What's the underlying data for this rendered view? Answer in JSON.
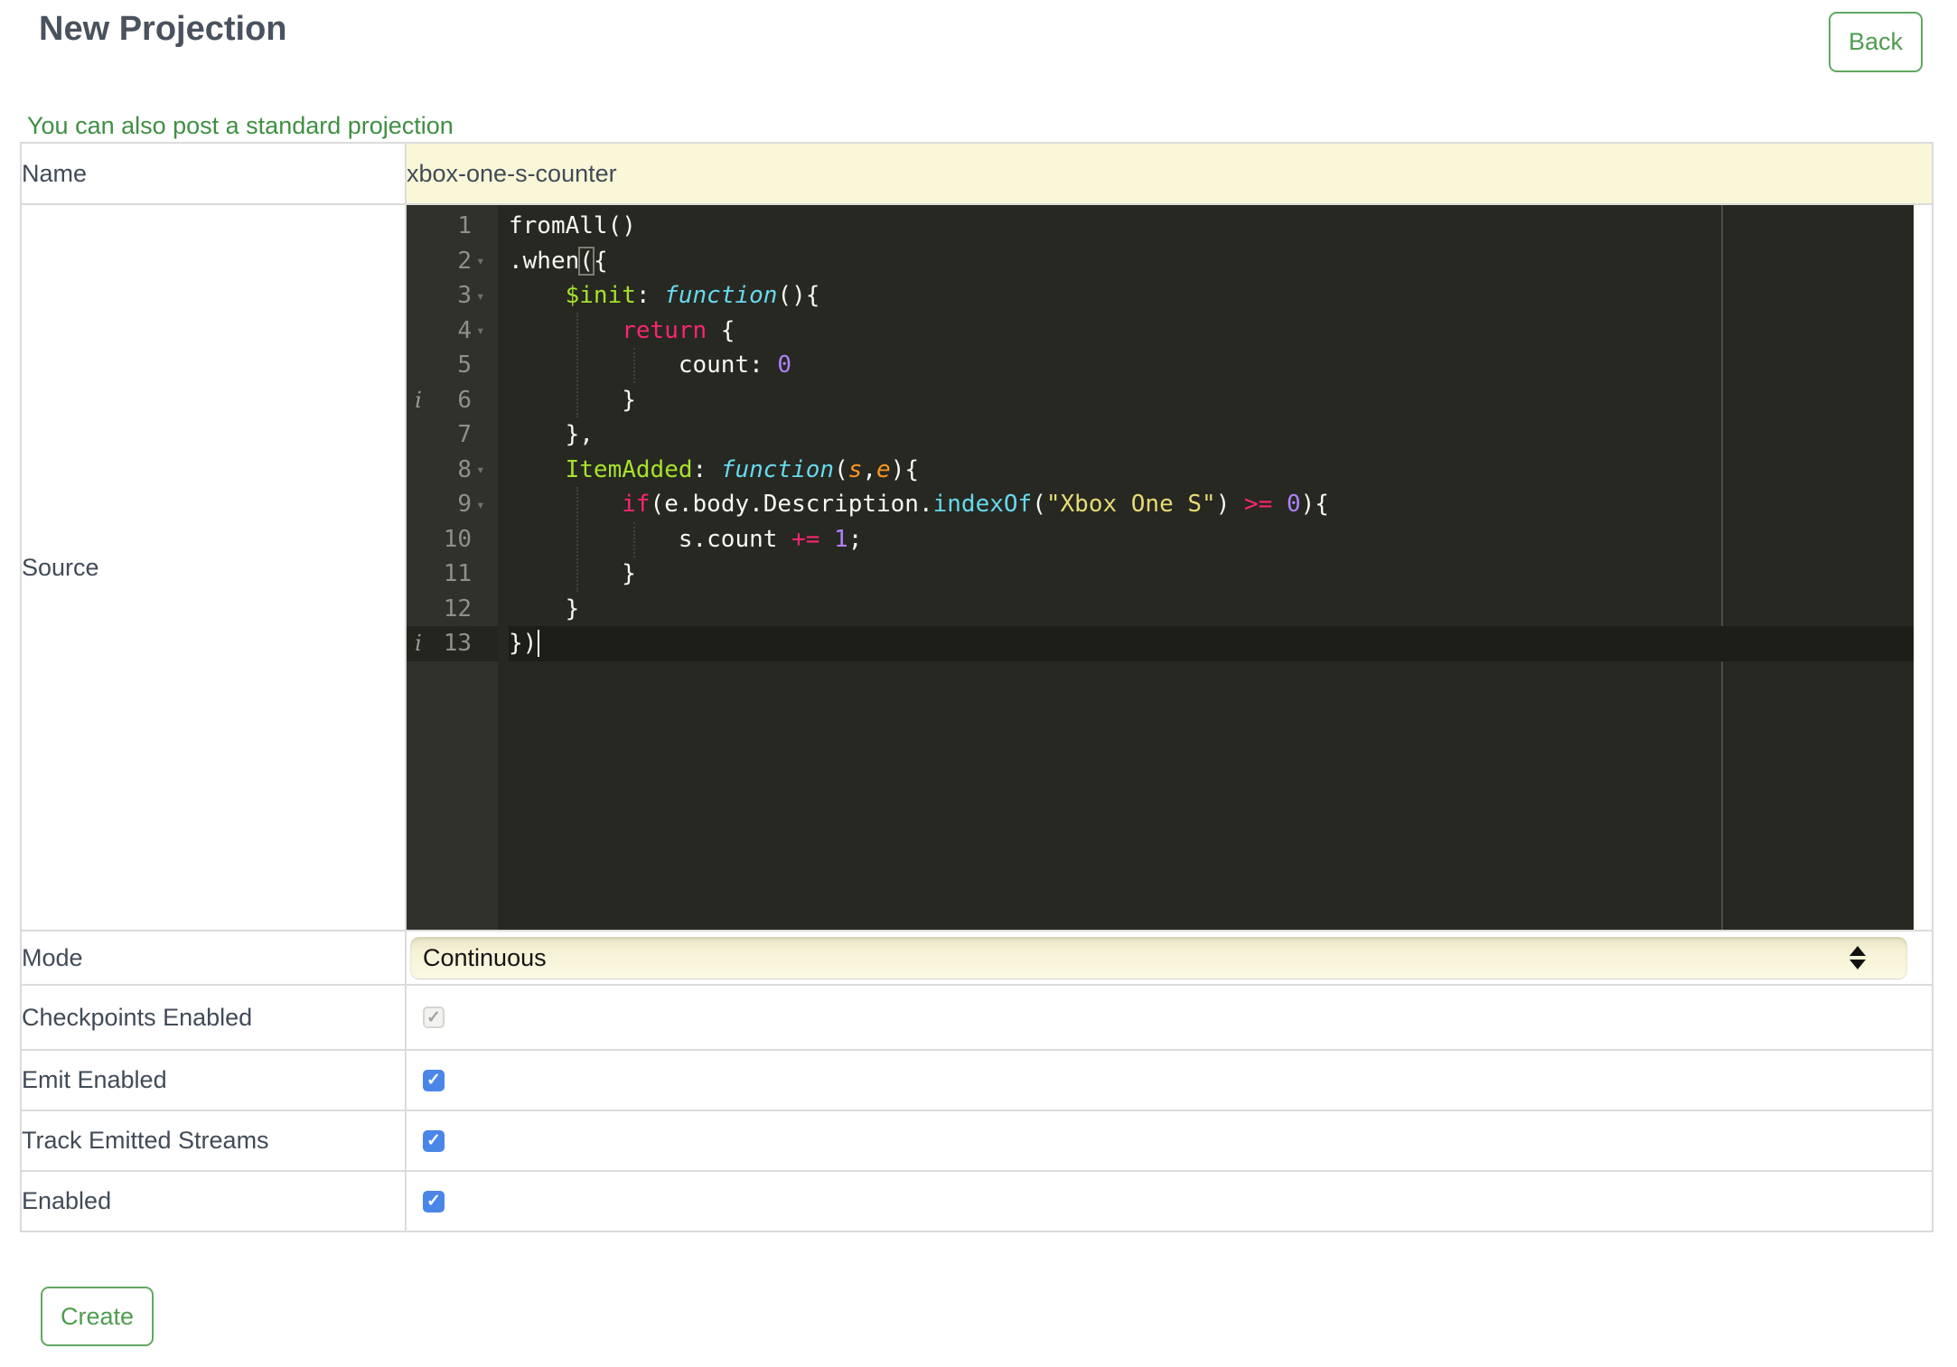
{
  "header": {
    "title": "New Projection",
    "back_label": "Back",
    "standard_projection_link": "You can also post a standard projection"
  },
  "form": {
    "name_label": "Name",
    "name_value": "xbox-one-s-counter",
    "source_label": "Source",
    "mode_label": "Mode",
    "mode_value": "Continuous",
    "checkboxes": [
      {
        "label": "Checkpoints Enabled",
        "checked": true,
        "disabled": true
      },
      {
        "label": "Emit Enabled",
        "checked": true,
        "disabled": false
      },
      {
        "label": "Track Emitted Streams",
        "checked": true,
        "disabled": false
      },
      {
        "label": "Enabled",
        "checked": true,
        "disabled": false
      }
    ],
    "create_label": "Create"
  },
  "colors": {
    "accent_green": "#4f9d4f",
    "link_green": "#3f8f42",
    "checkbox_blue": "#4a86e8",
    "name_field_yellow": "#faf7d9",
    "editor_background": "#272821",
    "gutter_background": "#30312b",
    "title_slate": "#49525e"
  },
  "editor": {
    "language": "javascript",
    "line_count": 13,
    "lines": [
      {
        "num": 1,
        "tokens": [
          {
            "t": "fromAll()",
            "c": "plain"
          }
        ]
      },
      {
        "num": 2,
        "fold": true,
        "tokens": [
          {
            "t": ".when",
            "c": "plain"
          },
          {
            "t": "(",
            "c": "plain",
            "b": true
          },
          {
            "t": "{",
            "c": "plain"
          }
        ]
      },
      {
        "num": 3,
        "fold": true,
        "tokens": [
          {
            "t": "    ",
            "c": "plain"
          },
          {
            "t": "$init",
            "c": "entity"
          },
          {
            "t": ": ",
            "c": "plain"
          },
          {
            "t": "function",
            "c": "storage"
          },
          {
            "t": "(){",
            "c": "plain"
          }
        ]
      },
      {
        "num": 4,
        "fold": true,
        "tokens": [
          {
            "t": "        ",
            "c": "plain"
          },
          {
            "t": "return",
            "c": "keyword"
          },
          {
            "t": " {",
            "c": "plain"
          }
        ]
      },
      {
        "num": 5,
        "tokens": [
          {
            "t": "            count: ",
            "c": "plain"
          },
          {
            "t": "0",
            "c": "number"
          }
        ]
      },
      {
        "num": 6,
        "info": true,
        "tokens": [
          {
            "t": "        }",
            "c": "plain"
          }
        ]
      },
      {
        "num": 7,
        "tokens": [
          {
            "t": "    },",
            "c": "plain"
          }
        ]
      },
      {
        "num": 8,
        "fold": true,
        "tokens": [
          {
            "t": "    ",
            "c": "plain"
          },
          {
            "t": "ItemAdded",
            "c": "entity"
          },
          {
            "t": ": ",
            "c": "plain"
          },
          {
            "t": "function",
            "c": "storage"
          },
          {
            "t": "(",
            "c": "plain"
          },
          {
            "t": "s",
            "c": "param"
          },
          {
            "t": ",",
            "c": "plain"
          },
          {
            "t": "e",
            "c": "param"
          },
          {
            "t": "){",
            "c": "plain"
          }
        ]
      },
      {
        "num": 9,
        "fold": true,
        "tokens": [
          {
            "t": "        ",
            "c": "plain"
          },
          {
            "t": "if",
            "c": "keyword"
          },
          {
            "t": "(e.body.Description.",
            "c": "plain"
          },
          {
            "t": "indexOf",
            "c": "support"
          },
          {
            "t": "(",
            "c": "plain"
          },
          {
            "t": "\"Xbox One S\"",
            "c": "string"
          },
          {
            "t": ") ",
            "c": "plain"
          },
          {
            "t": ">=",
            "c": "keyword"
          },
          {
            "t": " ",
            "c": "plain"
          },
          {
            "t": "0",
            "c": "number"
          },
          {
            "t": "){",
            "c": "plain"
          }
        ]
      },
      {
        "num": 10,
        "tokens": [
          {
            "t": "            s.count ",
            "c": "plain"
          },
          {
            "t": "+=",
            "c": "keyword"
          },
          {
            "t": " ",
            "c": "plain"
          },
          {
            "t": "1",
            "c": "number"
          },
          {
            "t": ";",
            "c": "plain"
          }
        ]
      },
      {
        "num": 11,
        "tokens": [
          {
            "t": "        }",
            "c": "plain"
          }
        ]
      },
      {
        "num": 12,
        "tokens": [
          {
            "t": "    }",
            "c": "plain"
          }
        ]
      },
      {
        "num": 13,
        "info": true,
        "active": true,
        "cursor": true,
        "tokens": [
          {
            "t": "})",
            "c": "plain"
          }
        ]
      }
    ]
  }
}
